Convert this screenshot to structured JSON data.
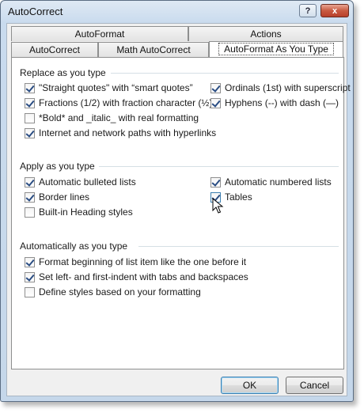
{
  "window": {
    "title": "AutoCorrect"
  },
  "title_buttons": {
    "help": "?",
    "close": "x"
  },
  "tabs": {
    "row1": [
      "AutoFormat",
      "Actions"
    ],
    "row2": [
      "AutoCorrect",
      "Math AutoCorrect",
      "AutoFormat As You Type"
    ],
    "active": "AutoFormat As You Type"
  },
  "sections": {
    "replace": {
      "title": "Replace as you type",
      "left": [
        {
          "label": "\"Straight quotes\" with “smart quotes”",
          "checked": true
        },
        {
          "label": "Fractions (1/2) with fraction character (½)",
          "checked": true
        },
        {
          "label": "*Bold* and _italic_ with real formatting",
          "checked": false
        },
        {
          "label": "Internet and network paths with hyperlinks",
          "checked": true
        }
      ],
      "right": [
        {
          "label": "Ordinals (1st) with superscript",
          "checked": true
        },
        {
          "label": "Hyphens (--) with dash (—)",
          "checked": true
        }
      ]
    },
    "apply": {
      "title": "Apply as you type",
      "left": [
        {
          "label": "Automatic bulleted lists",
          "checked": true
        },
        {
          "label": "Border lines",
          "checked": true
        },
        {
          "label": "Built-in Heading styles",
          "checked": false
        }
      ],
      "right": [
        {
          "label": "Automatic numbered lists",
          "checked": true
        },
        {
          "label": "Tables",
          "checked": true
        }
      ]
    },
    "auto": {
      "title": "Automatically as you type",
      "items": [
        {
          "label": "Format beginning of list item like the one before it",
          "checked": true
        },
        {
          "label": "Set left- and first-indent with tabs and backspaces",
          "checked": true
        },
        {
          "label": "Define styles based on your formatting",
          "checked": false
        }
      ]
    }
  },
  "buttons": {
    "ok": "OK",
    "cancel": "Cancel"
  }
}
